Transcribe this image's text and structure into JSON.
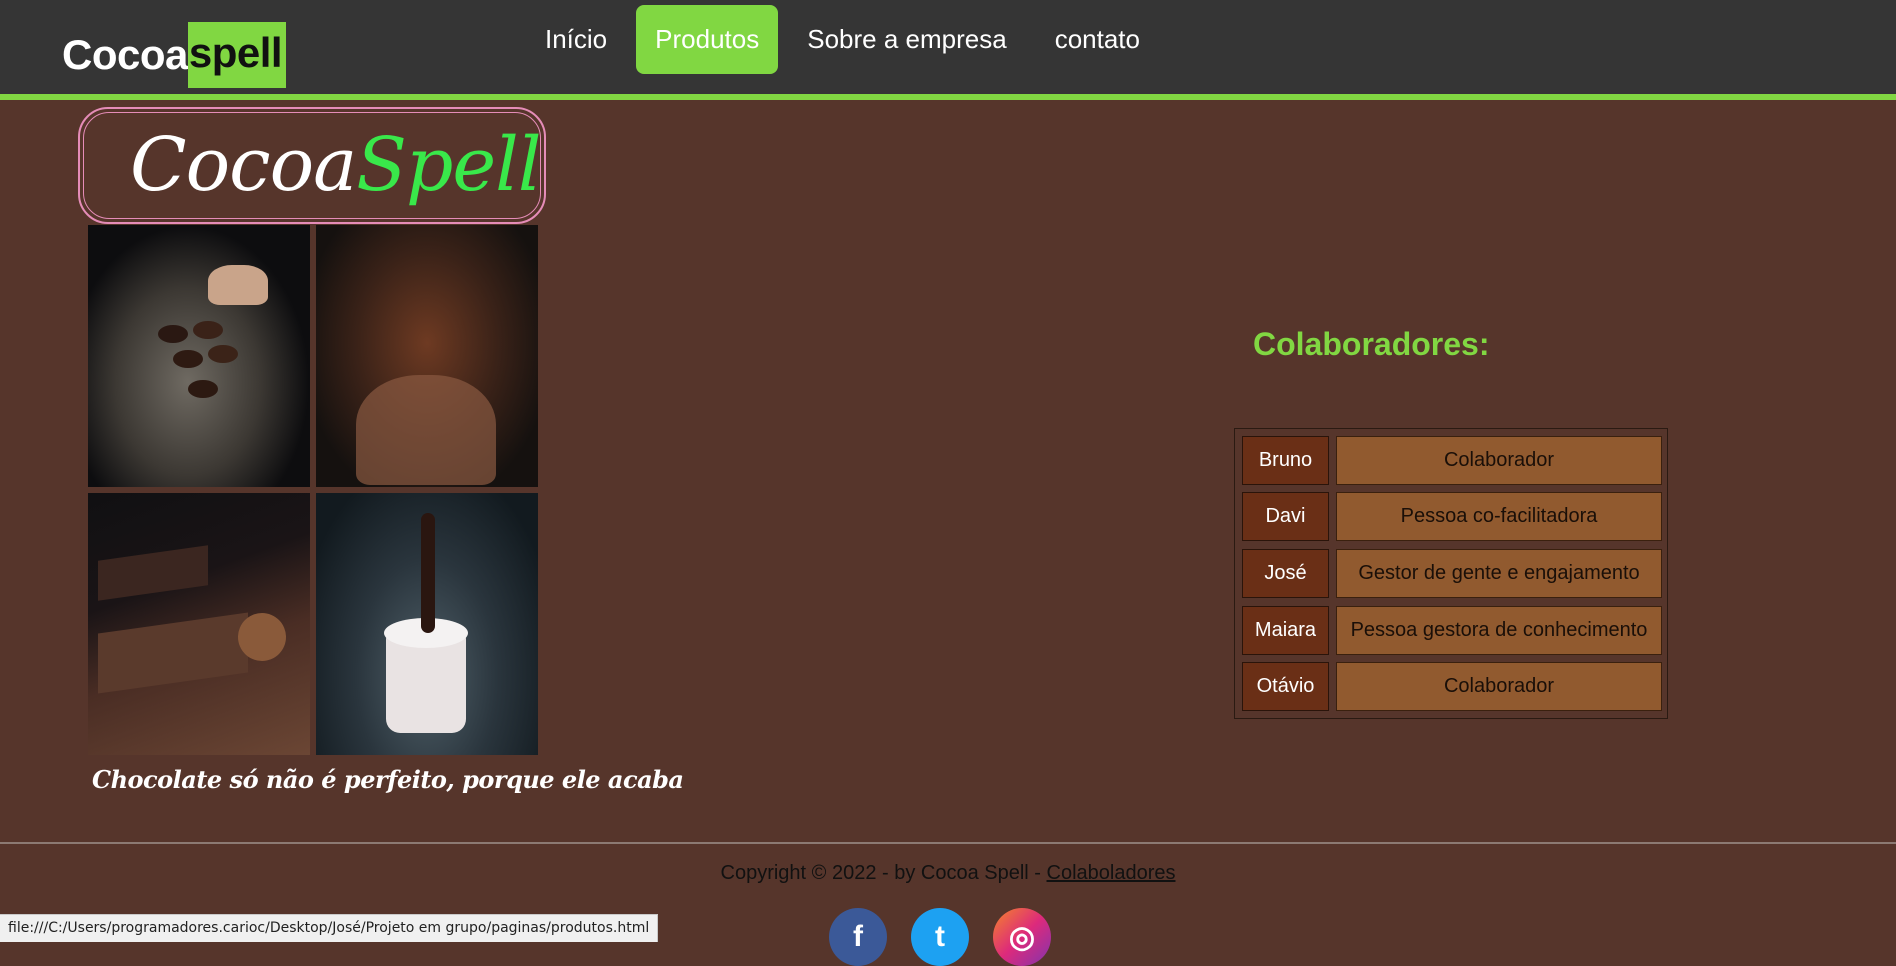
{
  "header": {
    "brand_part1": "Cocoa",
    "brand_part2": "spell",
    "nav": [
      {
        "label": "Início",
        "active": false
      },
      {
        "label": "Produtos",
        "active": true
      },
      {
        "label": "Sobre a empresa",
        "active": false
      },
      {
        "label": "contato",
        "active": false
      }
    ]
  },
  "logo": {
    "part1": "Cocoa",
    "part2": "Spell"
  },
  "tagline": "Chocolate só não é perfeito, porque ele acaba",
  "collaborators": {
    "title": "Colaboradores:",
    "rows": [
      {
        "name": "Bruno",
        "role": "Colaborador"
      },
      {
        "name": "Davi",
        "role": "Pessoa co-facilitadora"
      },
      {
        "name": "José",
        "role": "Gestor de gente e engajamento"
      },
      {
        "name": "Maiara",
        "role": "Pessoa gestora de conhecimento"
      },
      {
        "name": "Otávio",
        "role": "Colaborador"
      }
    ]
  },
  "footer": {
    "copyright": "Copyright © 2022 - by Cocoa Spell - ",
    "link": "Colaboladores",
    "social": [
      {
        "icon": "facebook-icon",
        "glyph": "f"
      },
      {
        "icon": "twitter-icon",
        "glyph": "t"
      },
      {
        "icon": "instagram-icon",
        "glyph": "◎"
      }
    ]
  },
  "statusbar": "file:///C:/Users/programadores.carioc/Desktop/José/Projeto em grupo/paginas/produtos.html",
  "colors": {
    "accent": "#81d742",
    "background": "#56352b",
    "header": "#353535"
  }
}
